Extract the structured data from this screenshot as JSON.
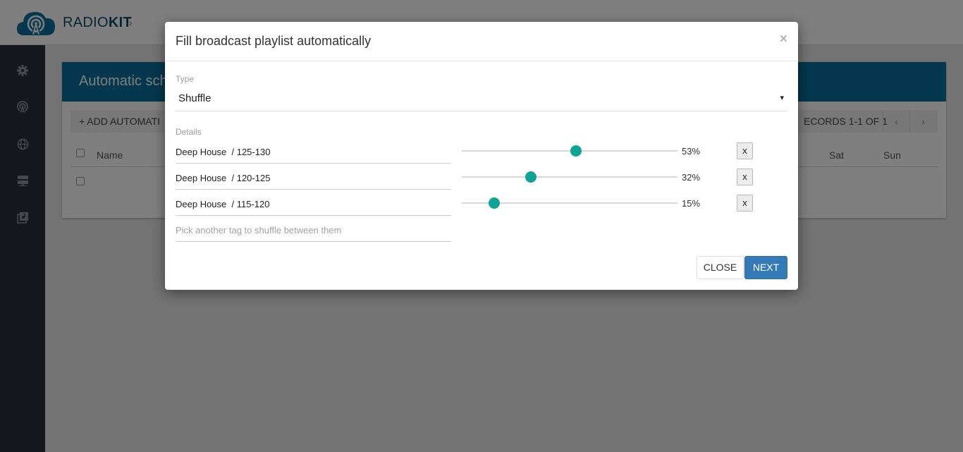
{
  "app": {
    "brand_light": "RADIO",
    "brand_bold": "KIT",
    "breadcrumb_chevron": "›",
    "logo_icon": "radio-tower-cloud-icon"
  },
  "sidebar": {
    "items": [
      {
        "icon": "gear-icon"
      },
      {
        "icon": "broadcast-icon"
      },
      {
        "icon": "globe-icon"
      },
      {
        "icon": "server-icon"
      },
      {
        "icon": "media-library-icon"
      }
    ]
  },
  "panel": {
    "title": "Automatic sch",
    "add_button": "+ ADD AUTOMATI",
    "records": "ECORDS 1-1 OF 1",
    "prev_page": "‹",
    "next_page": "›",
    "columns": {
      "name": "Name",
      "sat": "Sat",
      "sun": "Sun"
    }
  },
  "modal": {
    "title": "Fill broadcast playlist automatically",
    "close_symbol": "×",
    "type_label": "Type",
    "type_value": "Shuffle",
    "type_caret": "▾",
    "details_label": "Details",
    "tags": [
      {
        "name": "Deep House  / 125-130",
        "percent_label": "53%",
        "percent": 53
      },
      {
        "name": "Deep House  / 120-125",
        "percent_label": "32%",
        "percent": 32
      },
      {
        "name": "Deep House  / 115-120",
        "percent_label": "15%",
        "percent": 15
      }
    ],
    "remove_label": "x",
    "tag_placeholder": "Pick another tag to shuffle between them",
    "close_button": "CLOSE",
    "next_button": "NEXT"
  },
  "colors": {
    "accent": "#0fa393",
    "primary": "#337ab7",
    "panel_header": "#0a6e9c",
    "sidebar": "#2b3039"
  }
}
